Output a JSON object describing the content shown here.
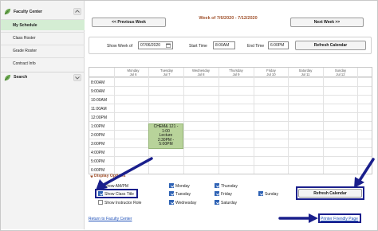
{
  "sidebar": {
    "header": "Faculty Center",
    "items": [
      {
        "label": "My Schedule",
        "active": true
      },
      {
        "label": "Class Roster",
        "active": false
      },
      {
        "label": "Grade Roster",
        "active": false
      },
      {
        "label": "Contract Info",
        "active": false
      }
    ],
    "search": "Search"
  },
  "nav": {
    "prev_week": "<< Previous Week",
    "next_week": "Next Week >>",
    "week_title": "Week of 7/6/2020 - 7/12/2020"
  },
  "filters": {
    "show_week_label": "Show Week of",
    "show_week_value": "07/06/2020",
    "start_time_label": "Start Time",
    "start_time_value": "8:00AM",
    "end_time_label": "End Time",
    "end_time_value": "6:00PM",
    "refresh": "Refresh Calendar"
  },
  "calendar": {
    "days": [
      {
        "name": "Monday",
        "date": "Jul 6"
      },
      {
        "name": "Tuesday",
        "date": "Jul 7"
      },
      {
        "name": "Wednesday",
        "date": "Jul 8"
      },
      {
        "name": "Thursday",
        "date": "Jul 9"
      },
      {
        "name": "Friday",
        "date": "Jul 10"
      },
      {
        "name": "Saturday",
        "date": "Jul 11"
      },
      {
        "name": "Sunday",
        "date": "Jul 12"
      }
    ],
    "times": [
      "8:00AM",
      "9:00AM",
      "10:00AM",
      "11:00AM",
      "12:00PM",
      "1:00PM",
      "2:00PM",
      "3:00PM",
      "4:00PM",
      "5:00PM",
      "6:00PM"
    ],
    "event": {
      "line1": "CHEM& 121 -",
      "line2": "1:00",
      "line3": "Lecture",
      "line4": "2:30PM -",
      "line5": "5:00PM",
      "color": "#b8d39a"
    }
  },
  "display_options": {
    "title": "Display Options",
    "col1": [
      {
        "label": "Show AM/PM",
        "checked": true
      },
      {
        "label": "Show Class Title",
        "checked": true
      },
      {
        "label": "Show Instructor Role",
        "checked": false
      }
    ],
    "col2": [
      {
        "label": "Monday",
        "checked": true
      },
      {
        "label": "Tuesday",
        "checked": true
      },
      {
        "label": "Wednesday",
        "checked": true
      }
    ],
    "col3": [
      {
        "label": "Thursday",
        "checked": true
      },
      {
        "label": "Friday",
        "checked": true
      },
      {
        "label": "Saturday",
        "checked": true
      }
    ],
    "col4": [
      {
        "label": "Sunday",
        "checked": true
      }
    ],
    "refresh": "Refresh Calendar"
  },
  "footer": {
    "return_link": "Return to Faculty Center",
    "printer_link": "Printer Friendly Page"
  },
  "colors": {
    "accent_brown": "#a0522d",
    "highlight_navy": "#1a1f8c",
    "link_blue": "#1d4fb8",
    "active_green": "#d4edd3",
    "checkbox_blue": "#2f63b5"
  }
}
